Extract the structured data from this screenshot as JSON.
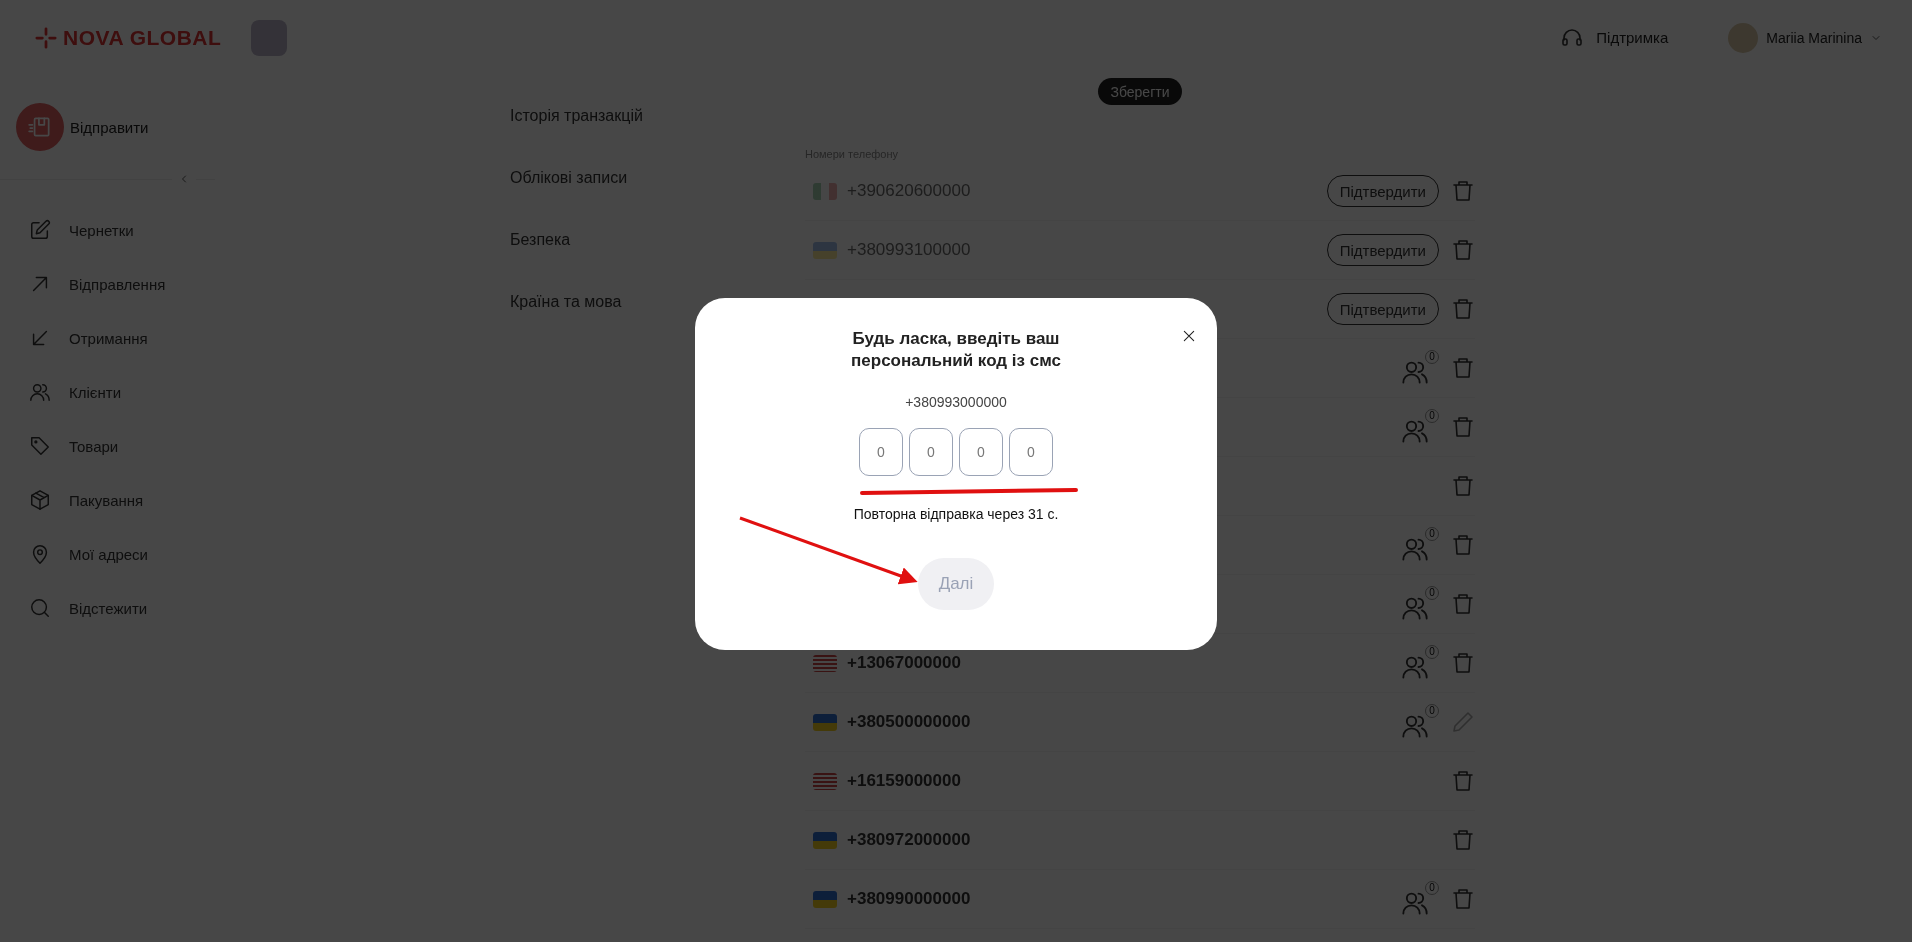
{
  "header": {
    "logo": "NOVA GLOBAL",
    "support": "Підтримка",
    "user": {
      "name": "Mariia Marinina"
    }
  },
  "sidebar": {
    "send_button": "Відправити",
    "items": [
      {
        "label": "Чернетки"
      },
      {
        "label": "Відправлення"
      },
      {
        "label": "Отримання"
      },
      {
        "label": "Клієнти"
      },
      {
        "label": "Товари"
      },
      {
        "label": "Пакування"
      },
      {
        "label": "Мої адреси"
      },
      {
        "label": "Відстежити"
      }
    ]
  },
  "settings_menu": {
    "items": [
      {
        "label": "Історія транзакцій"
      },
      {
        "label": "Облікові записи"
      },
      {
        "label": "Безпека"
      },
      {
        "label": "Країна та мова"
      }
    ]
  },
  "save_button": "Зберегти",
  "phones": {
    "label": "Номери телефону",
    "rows": [
      {
        "flag": {
          "kind": "it"
        },
        "number": "+390620600000",
        "verified": false,
        "confirm": "Підтвердити",
        "action": {
          "kind": "delete"
        }
      },
      {
        "flag": {
          "kind": "ua"
        },
        "number": "+380993100000",
        "verified": false,
        "confirm": "Підтвердити",
        "action": {
          "kind": "delete"
        }
      },
      {
        "confirm": "Підтвердити",
        "action": {
          "kind": "delete"
        }
      },
      {
        "contacts": "0",
        "action": {
          "kind": "delete"
        }
      },
      {
        "contacts": "0",
        "action": {
          "kind": "delete"
        }
      },
      {
        "action": {
          "kind": "delete"
        }
      },
      {
        "contacts": "0",
        "action": {
          "kind": "delete"
        }
      },
      {
        "contacts": "0",
        "action": {
          "kind": "delete"
        }
      },
      {
        "flag": {
          "kind": "us"
        },
        "number": "+13067000000",
        "verified": true,
        "contacts": "0",
        "action": {
          "kind": "delete"
        }
      },
      {
        "flag": {
          "kind": "ua"
        },
        "number": "+380500000000",
        "verified": true,
        "contacts": "0",
        "action": {
          "kind": "edit"
        }
      },
      {
        "flag": {
          "kind": "us"
        },
        "number": "+16159000000",
        "verified": true,
        "action": {
          "kind": "delete"
        }
      },
      {
        "flag": {
          "kind": "ua"
        },
        "number": "+380972000000",
        "verified": true,
        "action": {
          "kind": "delete"
        }
      },
      {
        "flag": {
          "kind": "ua"
        },
        "number": "+380990000000",
        "verified": true,
        "contacts": "0",
        "action": {
          "kind": "delete"
        }
      }
    ]
  },
  "modal": {
    "title": "Будь ласка, введіть ваш персональний код із смс",
    "phone": "+380993000000",
    "code_fields": [
      {
        "placeholder": "0"
      },
      {
        "placeholder": "0"
      },
      {
        "placeholder": "0"
      },
      {
        "placeholder": "0"
      }
    ],
    "resend": "Повторна відправка через 31 с.",
    "next_button": {
      "label": "Далі",
      "disabled": true
    }
  }
}
